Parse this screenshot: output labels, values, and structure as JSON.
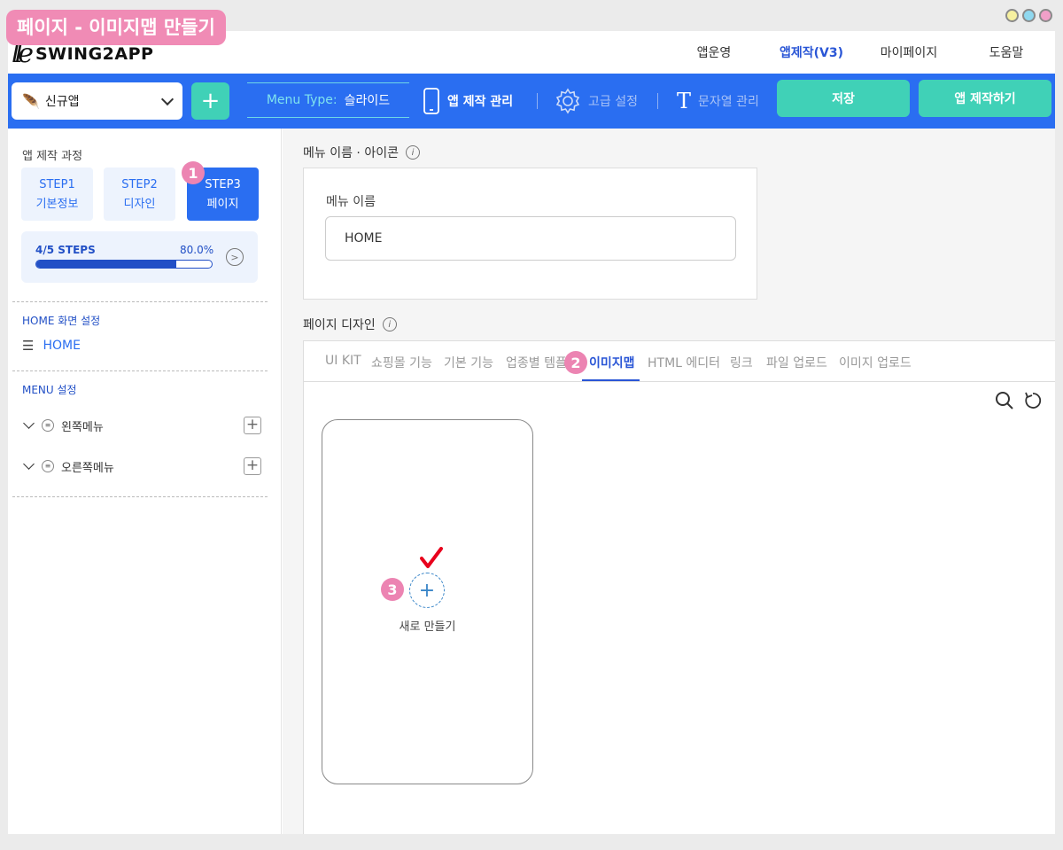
{
  "badge": {
    "title": "페이지 - 이미지맵 만들기"
  },
  "logo": {
    "mark": "lle",
    "text": "SWING2APP"
  },
  "nav": [
    {
      "label": "앱운영",
      "active": false
    },
    {
      "label": "앱제작(V3)",
      "active": true
    },
    {
      "label": "마이페이지",
      "active": false
    },
    {
      "label": "도움말",
      "active": false
    }
  ],
  "toolbar": {
    "app_name": "신규앱",
    "add_symbol": "+",
    "menu_type_label": "Menu Type:",
    "menu_type_value": "슬라이드",
    "app_manage": "앱 제작 관리",
    "advanced": "고급 설정",
    "strings": "문자열 관리",
    "save": "저장",
    "build": "앱 제작하기"
  },
  "sidebar": {
    "process_label": "앱 제작 과정",
    "steps": [
      {
        "line1": "STEP1",
        "line2": "기본정보"
      },
      {
        "line1": "STEP2",
        "line2": "디자인"
      },
      {
        "line1": "STEP3",
        "line2": "페이지"
      }
    ],
    "progress": {
      "text": "4/5 STEPS",
      "percent_text": "80.0%",
      "percent": 80
    },
    "home_section": "HOME 화면 설정",
    "home_item": "HOME",
    "menu_section": "MENU 설정",
    "menus": [
      {
        "label": "왼쪽메뉴"
      },
      {
        "label": "오른쪽메뉴"
      }
    ]
  },
  "markers": {
    "one": "1",
    "two": "2",
    "three": "3"
  },
  "main": {
    "name_section": "메뉴 이름 · 아이콘",
    "name_label": "메뉴 이름",
    "name_value": "HOME",
    "design_section": "페이지 디자인",
    "tabs": [
      {
        "label": "UI KIT"
      },
      {
        "label": "쇼핑몰 기능"
      },
      {
        "label": "기본 기능"
      },
      {
        "label": "업종별 템플"
      },
      {
        "label": "이미지맵"
      },
      {
        "label": "HTML 에디터"
      },
      {
        "label": "링크"
      },
      {
        "label": "파일 업로드"
      },
      {
        "label": "이미지 업로드"
      }
    ],
    "new_symbol": "+",
    "new_label": "새로 만들기"
  },
  "colors": {
    "brand_blue": "#2a6ef1",
    "accent_green": "#40d1b7",
    "marker_pink": "#ec84b2",
    "check_red": "#e8001c"
  }
}
